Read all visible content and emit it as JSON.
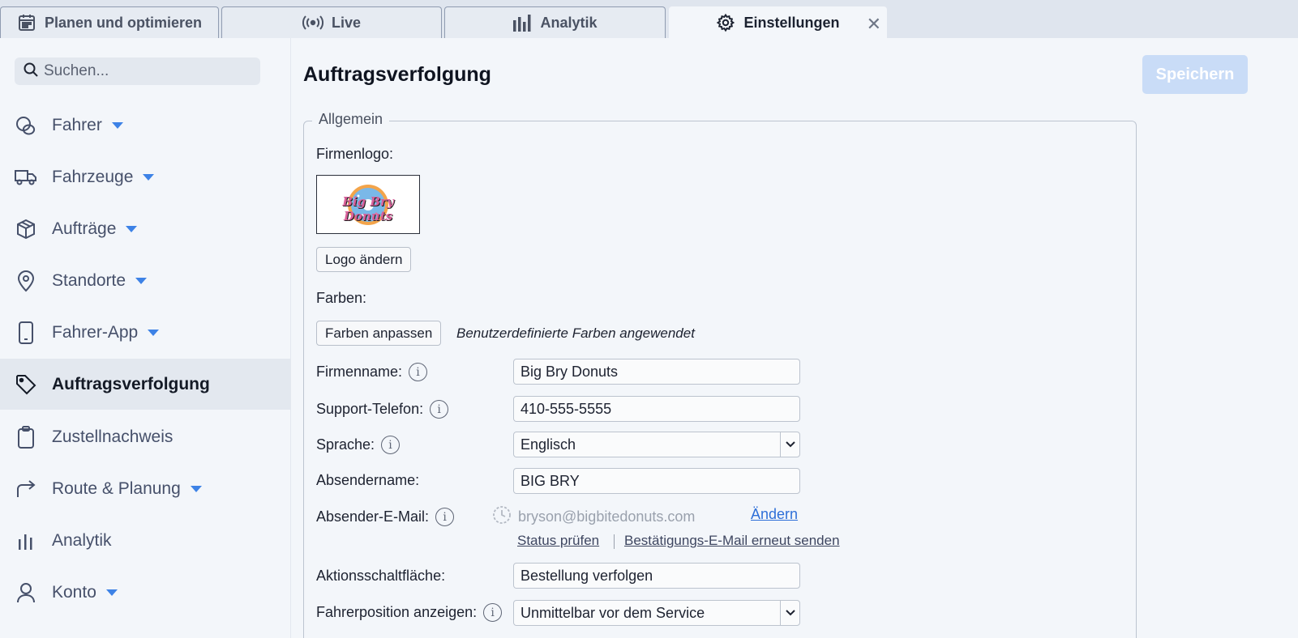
{
  "tabs": [
    {
      "label": "Planen und optimieren",
      "icon": "calendar-icon"
    },
    {
      "label": "Live",
      "icon": "broadcast-icon"
    },
    {
      "label": "Analytik",
      "icon": "bar-chart-icon"
    },
    {
      "label": "Einstellungen",
      "icon": "gear-icon",
      "active": true,
      "close": "✕"
    }
  ],
  "search": {
    "placeholder": "Suchen..."
  },
  "sidebar": {
    "items": [
      {
        "label": "Fahrer",
        "icon": "driver-icon",
        "caret": true
      },
      {
        "label": "Fahrzeuge",
        "icon": "truck-icon",
        "caret": true
      },
      {
        "label": "Aufträge",
        "icon": "package-icon",
        "caret": true
      },
      {
        "label": "Standorte",
        "icon": "location-pin-icon",
        "caret": true
      },
      {
        "label": "Fahrer-App",
        "icon": "phone-icon",
        "caret": true
      },
      {
        "label": "Auftragsverfolgung",
        "icon": "tag-icon",
        "active": true
      },
      {
        "label": "Zustellnachweis",
        "icon": "clipboard-icon"
      },
      {
        "label": "Route & Planung",
        "icon": "route-arrow-icon",
        "caret": true
      },
      {
        "label": "Analytik",
        "icon": "bar-chart-icon"
      },
      {
        "label": "Konto",
        "icon": "user-icon",
        "caret": true
      }
    ]
  },
  "main": {
    "title": "Auftragsverfolgung",
    "save_label": "Speichern",
    "section_legend": "Allgemein",
    "logo_label": "Firmenlogo:",
    "logo_text": "Big Bry Donuts",
    "change_logo_label": "Logo ändern",
    "colors_label": "Farben:",
    "customize_colors_label": "Farben anpassen",
    "colors_note": "Benutzerdefinierte Farben angewendet",
    "fields": {
      "company_name": {
        "label": "Firmenname:",
        "value": "Big Bry Donuts"
      },
      "support_phone": {
        "label": "Support-Telefon:",
        "value": "410-555-5555"
      },
      "language": {
        "label": "Sprache:",
        "value": "Englisch"
      },
      "sender_name": {
        "label": "Absendername:",
        "value": "BIG BRY"
      },
      "sender_email": {
        "label": "Absender-E-Mail:",
        "value": "bryson@bigbitedonuts.com",
        "change_label": "Ändern",
        "check_status_label": "Status prüfen",
        "resend_label": "Bestätigungs-E-Mail erneut senden"
      },
      "action_button": {
        "label": "Aktionsschaltfläche:",
        "value": "Bestellung verfolgen"
      },
      "driver_position": {
        "label": "Fahrerposition anzeigen:",
        "value": "Unmittelbar vor dem Service"
      }
    }
  },
  "colors": {
    "accent": "#3d82e6",
    "save_disabled": "#c9dcf7",
    "link": "#2e6fd8"
  }
}
